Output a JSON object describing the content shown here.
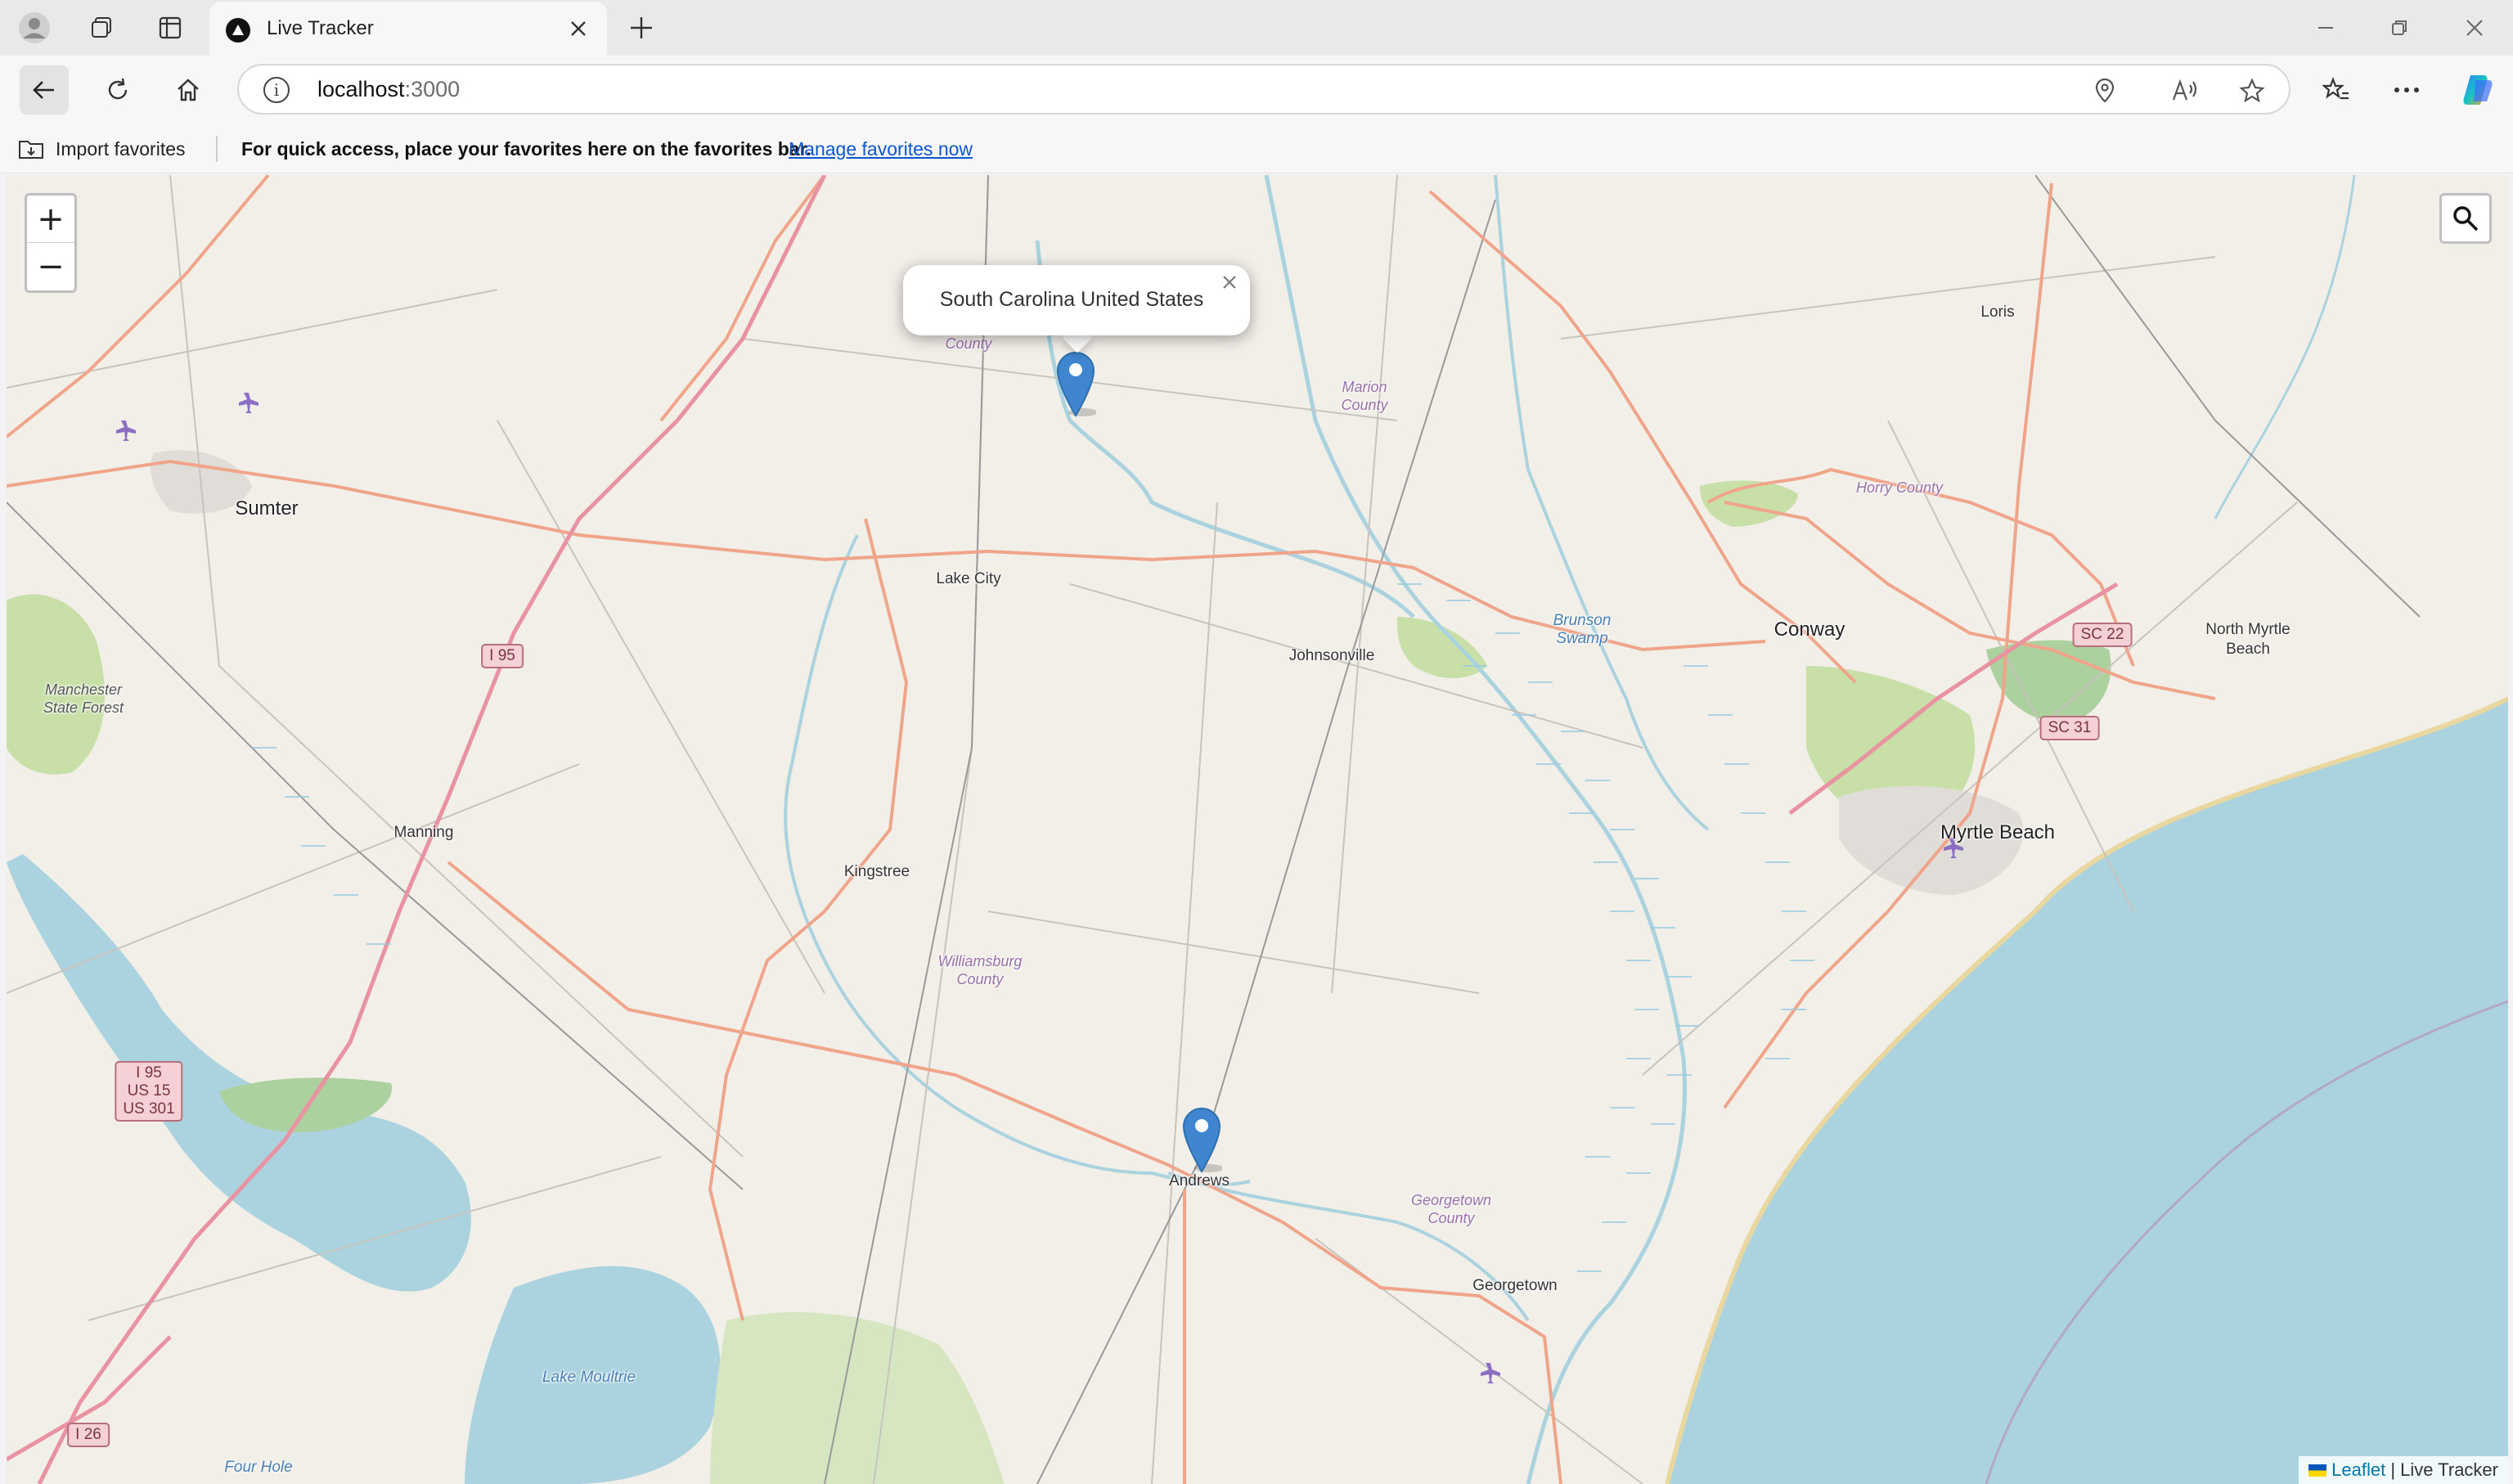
{
  "browser": {
    "tab_title": "Live Tracker",
    "url_host": "localhost",
    "url_port": ":3000"
  },
  "favorites_bar": {
    "import_label": "Import favorites",
    "hint_text": "For quick access, place your favorites here on the favorites bar.",
    "manage_link": "Manage favorites now"
  },
  "map": {
    "popup_text": "South Carolina United States",
    "attribution_leaflet": "Leaflet",
    "attribution_sep": " | ",
    "attribution_app": "Live Tracker",
    "zoom_in": "+",
    "zoom_out": "−",
    "places": {
      "sumter": "Sumter",
      "lake_city": "Lake City",
      "johnsonville": "Johnsonville",
      "manning": "Manning",
      "kingstree": "Kingstree",
      "andrews": "Andrews",
      "georgetown": "Georgetown",
      "conway": "Conway",
      "loris": "Loris",
      "myrtle_beach": "Myrtle Beach",
      "north_myrtle_beach": "North Myrtle\nBeach"
    },
    "counties": {
      "county_top": "County",
      "marion": "Marion\nCounty",
      "horry": "Horry County",
      "williamsburg": "Williamsburg\nCounty",
      "georgetown": "Georgetown\nCounty"
    },
    "water": {
      "lake_moultrie": "Lake Moultrie",
      "brunson_swamp": "Brunson\nSwamp",
      "four_hole": "Four Hole"
    },
    "forest": {
      "manchester": "Manchester\nState Forest"
    },
    "shields": {
      "i95": "I 95",
      "i95_multi": "I 95\nUS 15\nUS 301",
      "i26": "I 26",
      "sc22": "SC 22",
      "sc31": "SC 31"
    }
  }
}
